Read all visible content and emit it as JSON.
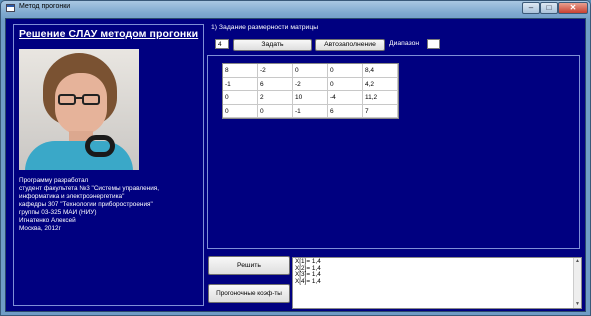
{
  "window": {
    "title": "Метод прогонки"
  },
  "left": {
    "heading": "Решение СЛАУ методом прогонки",
    "credits": [
      "Программу разработал",
      "студент факультета №3 \"Системы управления,",
      "информатика и электроэнергетика\"",
      "кафедры 307 \"Технологии приборостроения\"",
      "группы 03-325 МАИ (НИУ)",
      "Игнатенко Алексей",
      "Москва, 2012г"
    ]
  },
  "controls": {
    "section_label": "1) Задание размерности матрицы",
    "size_value": "4",
    "set_button": "Задать",
    "autofill_button": "Автозаполнение",
    "range_label": "Диапазон",
    "range_value": ""
  },
  "matrix": [
    [
      "8",
      "-2",
      "0",
      "0",
      "8,4"
    ],
    [
      "-1",
      "6",
      "-2",
      "0",
      "4,2"
    ],
    [
      "0",
      "2",
      "10",
      "-4",
      "11,2"
    ],
    [
      "0",
      "0",
      "-1",
      "6",
      "7"
    ]
  ],
  "actions": {
    "solve_button": "Решить",
    "coef_button": "Прогоночные коэф-ты"
  },
  "output": {
    "lines": [
      "X[1]= 1,4",
      "X[2]= 1,4",
      "X[3]= 1,4",
      "X[4]= 1,4"
    ]
  }
}
